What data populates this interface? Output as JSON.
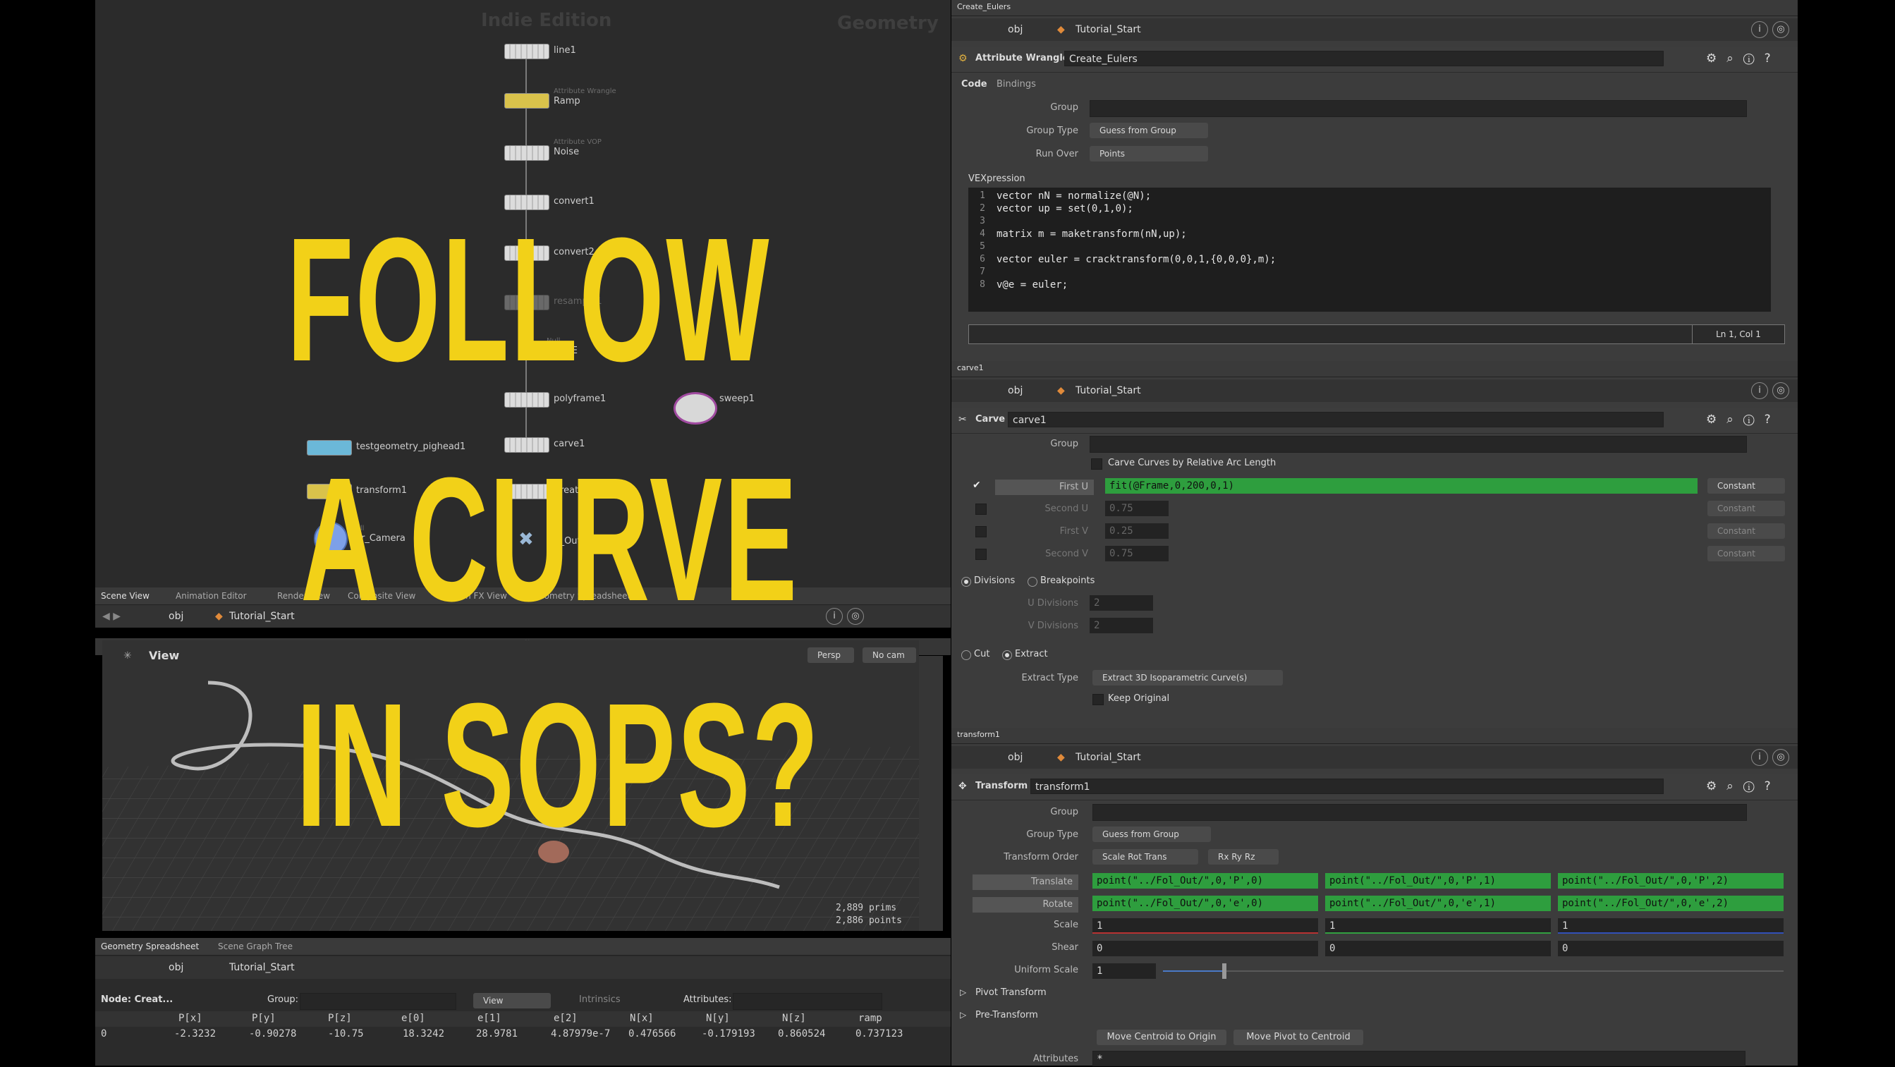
{
  "title_overlay": {
    "line1": "FOLLOW",
    "line2": "A CURVE",
    "line3": "IN SOPS?"
  },
  "network": {
    "watermark_left": "Indie Edition",
    "watermark_right": "Geometry",
    "nodes": [
      {
        "label": "line1",
        "sub": ""
      },
      {
        "label": "Ramp",
        "sub": "Attribute Wrangle"
      },
      {
        "label": "Noise",
        "sub": "Attribute VOP"
      },
      {
        "label": "convert1",
        "sub": ""
      },
      {
        "label": "convert2",
        "sub": ""
      },
      {
        "label": "resample1",
        "sub": ""
      },
      {
        "label": "CURVE",
        "sub": "Null"
      },
      {
        "label": "polyframe1",
        "sub": ""
      },
      {
        "label": "sweep1",
        "sub": ""
      },
      {
        "label": "testgeometry_pighead1",
        "sub": ""
      },
      {
        "label": "carve1",
        "sub": ""
      },
      {
        "label": "transform1",
        "sub": ""
      },
      {
        "label": "Create_Eulers",
        "sub": ""
      },
      {
        "label": "For_Camera",
        "sub": "Null"
      },
      {
        "label": "Fol_Out",
        "sub": "Null"
      }
    ]
  },
  "scene_tabs": [
    "Scene View",
    "Animation Editor",
    "Render View",
    "Composite View",
    "Motion FX View",
    "Geometry Spreadsheet"
  ],
  "scene_path": {
    "obj": "obj",
    "node": "Tutorial_Start"
  },
  "viewport": {
    "label": "View",
    "persp": "Persp",
    "cam": "No cam",
    "prims": "2,889  prims",
    "points": "2,886 points"
  },
  "sheet": {
    "tabs": [
      "Geometry Spreadsheet",
      "Scene Graph Tree"
    ],
    "path_obj": "obj",
    "path_node": "Tutorial_Start",
    "node_label": "Node: Creat...",
    "group_label": "Group:",
    "view_label": "View",
    "intrinsics_label": "Intrinsics",
    "attributes_label": "Attributes:",
    "columns": [
      "",
      "P[x]",
      "P[y]",
      "P[z]",
      "e[0]",
      "e[1]",
      "e[2]",
      "N[x]",
      "N[y]",
      "N[z]",
      "ramp"
    ],
    "rows": [
      [
        "0",
        "-2.3232",
        "-0.90278",
        "-10.75",
        "18.3242",
        "28.9781",
        "4.87979e-7",
        "0.476566",
        "-0.179193",
        "0.860524",
        "0.737123"
      ]
    ]
  },
  "pane1": {
    "tab": "Create_Eulers",
    "path_obj": "obj",
    "path_node": "Tutorial_Start",
    "node_type": "Attribute Wrangle",
    "node_name": "Create_Eulers",
    "subtabs": [
      "Code",
      "Bindings"
    ],
    "group_label": "Group",
    "group_type_label": "Group Type",
    "group_type_value": "Guess from Group",
    "run_over_label": "Run Over",
    "run_over_value": "Points",
    "vex_label": "VEXpression",
    "code_lines": [
      "vector nN = normalize(@N);",
      "vector up = set(0,1,0);",
      "",
      "matrix m = maketransform(nN,up);",
      "",
      "vector euler = cracktransform(0,0,1,{0,0,0},m);",
      "",
      "v@e = euler;"
    ],
    "status": "Ln 1, Col 1"
  },
  "pane2": {
    "tab": "carve1",
    "path_obj": "obj",
    "path_node": "Tutorial_Start",
    "node_type": "Carve",
    "node_name": "carve1",
    "group_label": "Group",
    "relarc_label": "Carve Curves by Relative Arc Length",
    "firstu_label": "First U",
    "firstu_value": "fit(@Frame,0,200,0,1)",
    "secondu_label": "Second U",
    "secondu_value": "0.75",
    "firstv_label": "First V",
    "firstv_value": "0.25",
    "secondv_label": "Second V",
    "secondv_value": "0.75",
    "constant": "Constant",
    "divisions_label": "Divisions",
    "breakpoints_label": "Breakpoints",
    "udiv_label": "U Divisions",
    "udiv_value": "2",
    "vdiv_label": "V Divisions",
    "vdiv_value": "2",
    "cut_label": "Cut",
    "extract_label": "Extract",
    "extract_type_label": "Extract Type",
    "extract_type_value": "Extract 3D Isoparametric Curve(s)",
    "keep_original_label": "Keep Original"
  },
  "pane3": {
    "tab": "transform1",
    "path_obj": "obj",
    "path_node": "Tutorial_Start",
    "node_type": "Transform",
    "node_name": "transform1",
    "group_label": "Group",
    "group_type_label": "Group Type",
    "group_type_value": "Guess from Group",
    "order_label": "Transform Order",
    "order_value": "Scale Rot Trans",
    "rot_order_value": "Rx Ry Rz",
    "translate_label": "Translate",
    "translate": [
      "point(\"../Fol_Out/\",0,'P',0)",
      "point(\"../Fol_Out/\",0,'P',1)",
      "point(\"../Fol_Out/\",0,'P',2)"
    ],
    "rotate_label": "Rotate",
    "rotate": [
      "point(\"../Fol_Out/\",0,'e',0)",
      "point(\"../Fol_Out/\",0,'e',1)",
      "point(\"../Fol_Out/\",0,'e',2)"
    ],
    "scale_label": "Scale",
    "scale": [
      "1",
      "1",
      "1"
    ],
    "shear_label": "Shear",
    "shear": [
      "0",
      "0",
      "0"
    ],
    "uniform_label": "Uniform Scale",
    "uniform_value": "1",
    "pivot_label": "Pivot Transform",
    "pre_label": "Pre-Transform",
    "centroid_btn": "Move Centroid to Origin",
    "pivot_btn": "Move Pivot to Centroid",
    "attributes_label": "Attributes",
    "attributes_value": "*"
  },
  "colors": {
    "title": "#f2d118",
    "expr_green": "#2e9e3e"
  }
}
